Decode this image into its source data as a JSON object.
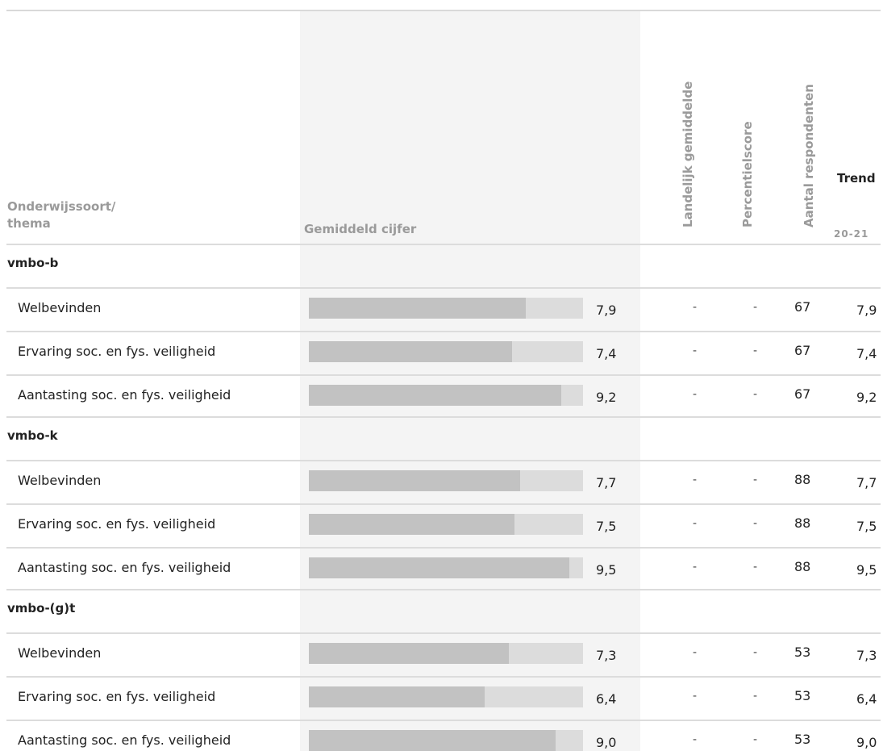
{
  "header": {
    "col1_line1": "Onderwijssoort/",
    "col1_line2": "thema",
    "col2": "Gemiddeld cijfer",
    "col3": "Landelijk gemiddelde",
    "col4": "Percentielscore",
    "col5": "Aantal respondenten",
    "trend": "Trend",
    "period": "20-21"
  },
  "colors": {
    "bar_fill": "#c2c2c2",
    "bar_track": "#dcdcdc",
    "highlight_column": "#f4f4f4",
    "header_text": "#9a9a9a"
  },
  "chart_data": {
    "type": "bar",
    "orientation": "horizontal",
    "xlim": [
      0,
      10
    ],
    "groups": [
      "vmbo-b",
      "vmbo-k",
      "vmbo-(g)t"
    ],
    "rows": [
      {
        "group": "vmbo-b",
        "theme": "Welbevinden",
        "value": 7.9,
        "value_label": "7,9",
        "landelijk": "-",
        "percentiel": "-",
        "respondenten": "67",
        "trend": "7,9"
      },
      {
        "group": "vmbo-b",
        "theme": "Ervaring soc. en fys. veiligheid",
        "value": 7.4,
        "value_label": "7,4",
        "landelijk": "-",
        "percentiel": "-",
        "respondenten": "67",
        "trend": "7,4"
      },
      {
        "group": "vmbo-b",
        "theme": "Aantasting soc. en fys. veiligheid",
        "value": 9.2,
        "value_label": "9,2",
        "landelijk": "-",
        "percentiel": "-",
        "respondenten": "67",
        "trend": "9,2"
      },
      {
        "group": "vmbo-k",
        "theme": "Welbevinden",
        "value": 7.7,
        "value_label": "7,7",
        "landelijk": "-",
        "percentiel": "-",
        "respondenten": "88",
        "trend": "7,7"
      },
      {
        "group": "vmbo-k",
        "theme": "Ervaring soc. en fys. veiligheid",
        "value": 7.5,
        "value_label": "7,5",
        "landelijk": "-",
        "percentiel": "-",
        "respondenten": "88",
        "trend": "7,5"
      },
      {
        "group": "vmbo-k",
        "theme": "Aantasting soc. en fys. veiligheid",
        "value": 9.5,
        "value_label": "9,5",
        "landelijk": "-",
        "percentiel": "-",
        "respondenten": "88",
        "trend": "9,5"
      },
      {
        "group": "vmbo-(g)t",
        "theme": "Welbevinden",
        "value": 7.3,
        "value_label": "7,3",
        "landelijk": "-",
        "percentiel": "-",
        "respondenten": "53",
        "trend": "7,3"
      },
      {
        "group": "vmbo-(g)t",
        "theme": "Ervaring soc. en fys. veiligheid",
        "value": 6.4,
        "value_label": "6,4",
        "landelijk": "-",
        "percentiel": "-",
        "respondenten": "53",
        "trend": "6,4"
      },
      {
        "group": "vmbo-(g)t",
        "theme": "Aantasting soc. en fys. veiligheid",
        "value": 9.0,
        "value_label": "9,0",
        "landelijk": "-",
        "percentiel": "-",
        "respondenten": "53",
        "trend": "9,0"
      }
    ]
  }
}
